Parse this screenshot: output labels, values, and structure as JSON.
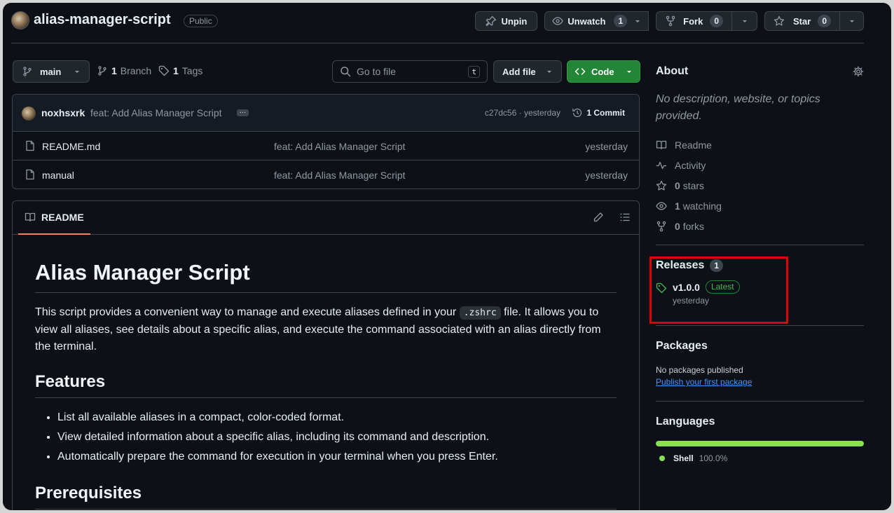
{
  "repo": {
    "name": "alias-manager-script",
    "visibility": "Public"
  },
  "header_actions": {
    "unpin": "Unpin",
    "unwatch": "Unwatch",
    "watch_count": "1",
    "fork": "Fork",
    "fork_count": "0",
    "star": "Star",
    "star_count": "0"
  },
  "toolbar": {
    "branch": "main",
    "branches_count": "1",
    "branches_label": "Branch",
    "tags_count": "1",
    "tags_label": "Tags",
    "goto_placeholder": "Go to file",
    "goto_key": "t",
    "add_file": "Add file",
    "code": "Code"
  },
  "latest_commit": {
    "author": "noxhsxrk",
    "message": "feat: Add Alias Manager Script",
    "sha": "c27dc56",
    "sep": "·",
    "time": "yesterday",
    "count_label": "1 Commit"
  },
  "files": [
    {
      "name": "README.md",
      "message": "feat: Add Alias Manager Script",
      "time": "yesterday"
    },
    {
      "name": "manual",
      "message": "feat: Add Alias Manager Script",
      "time": "yesterday"
    }
  ],
  "readme": {
    "tab": "README",
    "title": "Alias Manager Script",
    "intro_before": "This script provides a convenient way to manage and execute aliases defined in your ",
    "intro_code": ".zshrc",
    "intro_after": " file. It allows you to view all aliases, see details about a specific alias, and execute the command associated with an alias directly from the terminal.",
    "features_heading": "Features",
    "features": [
      "List all available aliases in a compact, color-coded format.",
      "View detailed information about a specific alias, including its command and description.",
      "Automatically prepare the command for execution in your terminal when you press Enter."
    ],
    "prereq_heading": "Prerequisites"
  },
  "about": {
    "heading": "About",
    "description": "No description, website, or topics provided.",
    "readme": "Readme",
    "activity": "Activity",
    "stars_count": "0",
    "stars_label": "stars",
    "watching_count": "1",
    "watching_label": "watching",
    "forks_count": "0",
    "forks_label": "forks"
  },
  "releases": {
    "heading": "Releases",
    "count": "1",
    "tag": "v1.0.0",
    "badge": "Latest",
    "time": "yesterday"
  },
  "packages": {
    "heading": "Packages",
    "empty": "No packages published",
    "link": "Publish your first package"
  },
  "languages": {
    "heading": "Languages",
    "items": [
      {
        "name": "Shell",
        "percent": "100.0%",
        "color": "#89e051"
      }
    ]
  },
  "colors": {
    "accent_green": "#238636",
    "highlight_box": "#e00000",
    "shell": "#89e051"
  }
}
